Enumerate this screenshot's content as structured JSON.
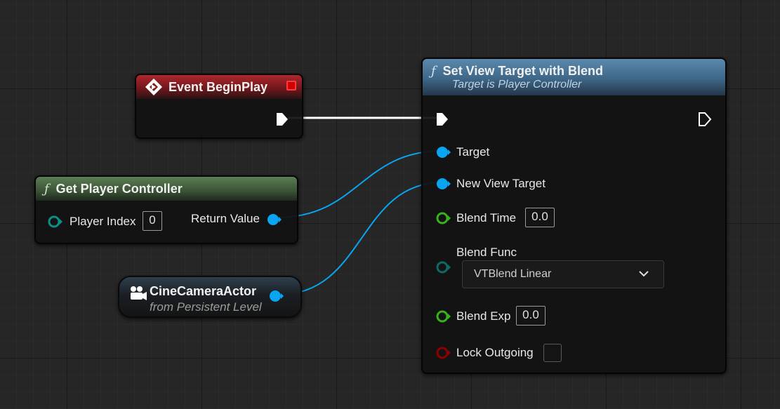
{
  "nodes": {
    "event_begin_play": {
      "title": "Event BeginPlay"
    },
    "get_player_controller": {
      "title": "Get Player Controller",
      "fx_glyph": "ƒ",
      "player_index_label": "Player Index",
      "player_index_value": "0",
      "return_value_label": "Return Value"
    },
    "cine_camera_actor": {
      "title": "CineCameraActor",
      "subtitle": "from Persistent Level"
    },
    "set_view_target": {
      "title": "Set View Target with Blend",
      "subtitle": "Target is Player Controller",
      "fx_glyph": "ƒ",
      "target_label": "Target",
      "new_view_target_label": "New View Target",
      "blend_time_label": "Blend Time",
      "blend_time_value": "0.0",
      "blend_func_label": "Blend Func",
      "blend_func_value": "VTBlend Linear",
      "blend_exp_label": "Blend Exp",
      "blend_exp_value": "0.0",
      "lock_outgoing_label": "Lock Outgoing",
      "lock_outgoing_checked": false
    }
  },
  "colors": {
    "exec_wire": "#ffffff",
    "object_pin": "#0aa5f0",
    "byte_pin": "#0d8f86",
    "float_pin": "#37b21c",
    "bool_pin": "#8c0000",
    "event_header": "#b0262d",
    "pure_func_header": "#5b7e53",
    "func_header": "#5a89ad"
  },
  "icons": {
    "event": "diamond-event-icon",
    "delegate": "red-square-delegate-icon",
    "function": "function-f-icon",
    "camera_actor": "camera-actor-icon",
    "dropdown": "chevron-down-icon"
  }
}
